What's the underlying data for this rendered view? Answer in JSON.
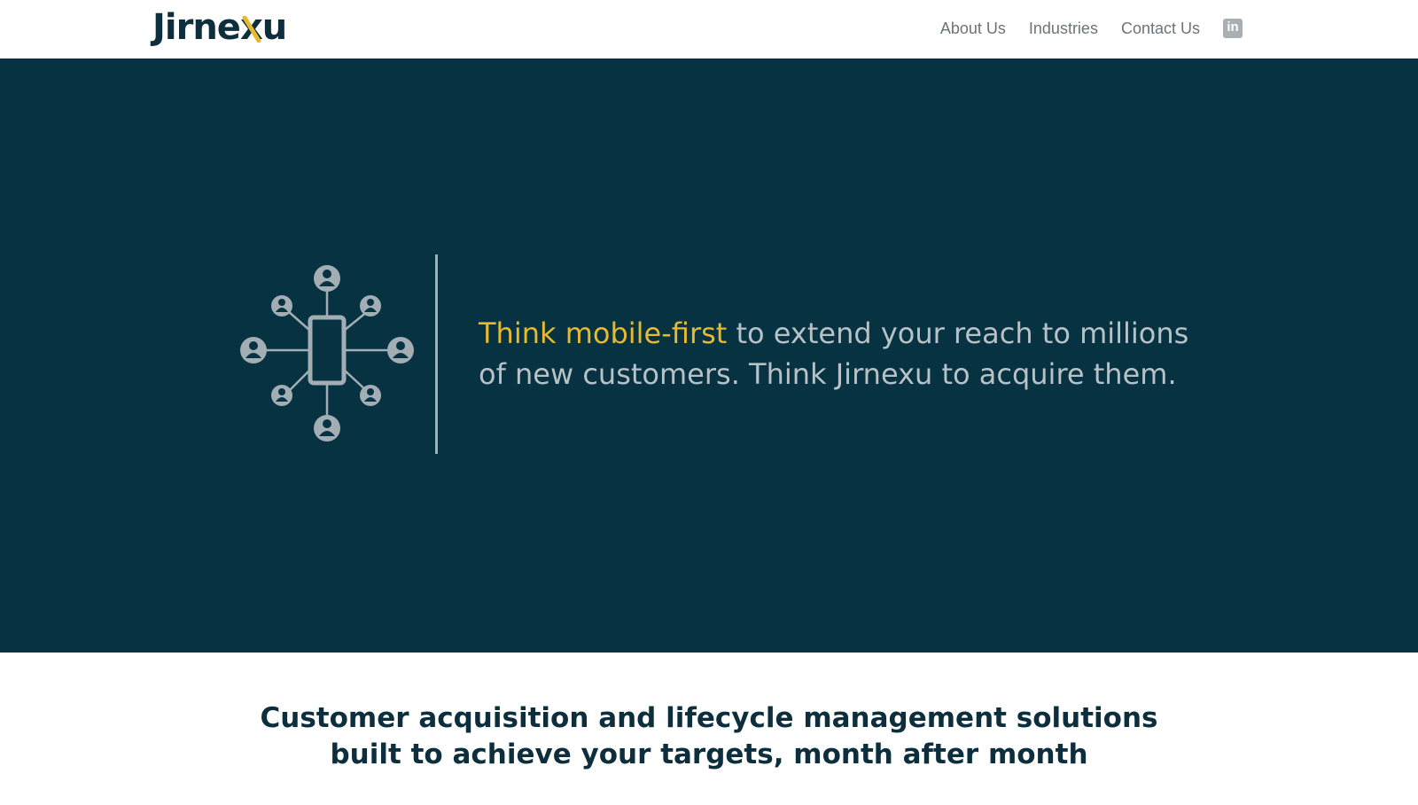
{
  "header": {
    "logo_text_pre": "Jirne",
    "logo_text_x": "x",
    "logo_text_post": "u",
    "nav": {
      "about": "About Us",
      "industries": "Industries",
      "contact": "Contact Us"
    },
    "social_icon": "linkedin-icon",
    "social_glyph": "in"
  },
  "hero": {
    "graphic_icon": "mobile-network-icon",
    "highlight": "Think mobile-first",
    "text_rest": " to extend your reach to millions of new customers. Think Jirnexu to acquire them."
  },
  "tagline": {
    "line1": "Customer acquisition and lifecycle management solutions",
    "line2": "built to achieve your targets, month after month"
  },
  "colors": {
    "brand_dark": "#063242",
    "accent_yellow": "#e6b92e",
    "hero_text": "#b7c1c6",
    "nav_text": "#6b747a"
  }
}
